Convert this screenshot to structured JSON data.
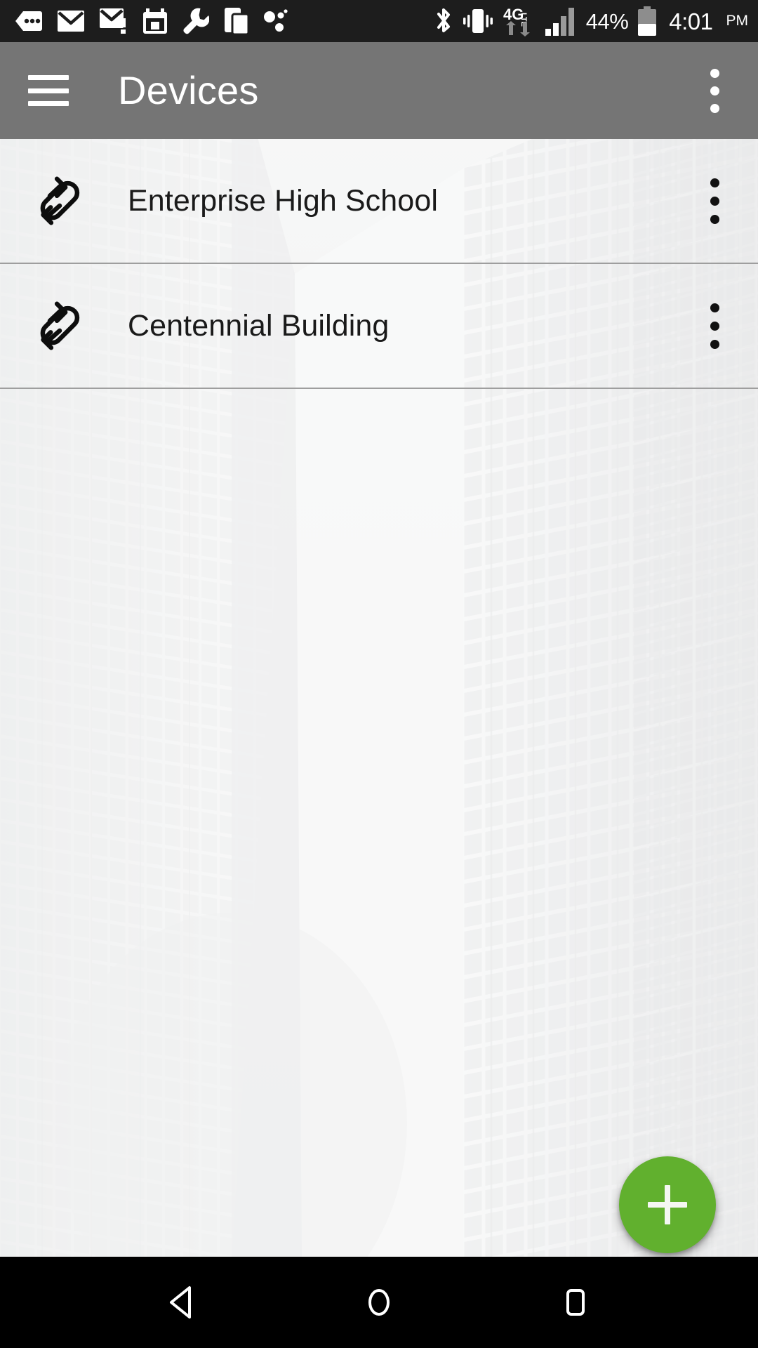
{
  "status_bar": {
    "background_color": "#1d1d1d",
    "left_icons": [
      {
        "name": "message-bubble-icon",
        "label": "Messages"
      },
      {
        "name": "mail-icon",
        "label": "Email"
      },
      {
        "name": "mail-alert-icon",
        "label": "Email alert"
      },
      {
        "name": "calendar-icon",
        "label": "Calendar"
      },
      {
        "name": "wrench-icon",
        "label": "Tools"
      },
      {
        "name": "screen-mirror-icon",
        "label": "Screen share"
      },
      {
        "name": "nearby-share-icon",
        "label": "Nearby"
      }
    ],
    "right_icons": [
      {
        "name": "bluetooth-icon",
        "label": "Bluetooth"
      },
      {
        "name": "vibrate-icon",
        "label": "Vibrate"
      },
      {
        "name": "network-4glte-icon",
        "label": "4G LTE"
      },
      {
        "name": "signal-bars-icon",
        "label": "Signal"
      }
    ],
    "battery_percent": "44%",
    "battery_level": 44,
    "time": "4:01",
    "ampm": "PM"
  },
  "app_bar": {
    "title": "Devices",
    "background_color": "#757575",
    "text_color": "#ffffff",
    "menu_icon": "hamburger-icon",
    "overflow_icon": "more-vert-icon"
  },
  "device_list": {
    "rows": [
      {
        "label": "Enterprise High School",
        "icon": "link-transfer-icon",
        "overflow_icon": "more-vert-icon"
      },
      {
        "label": "Centennial Building",
        "icon": "link-transfer-icon",
        "overflow_icon": "more-vert-icon"
      }
    ]
  },
  "fab": {
    "label": "+",
    "action": "add-device",
    "color": "#61b02e",
    "icon": "plus-icon"
  },
  "nav_bar": {
    "background_color": "#000000",
    "buttons": [
      {
        "name": "back-button",
        "icon": "triangle-back-icon"
      },
      {
        "name": "home-button",
        "icon": "circle-home-icon"
      },
      {
        "name": "recents-button",
        "icon": "square-recents-icon"
      }
    ]
  }
}
